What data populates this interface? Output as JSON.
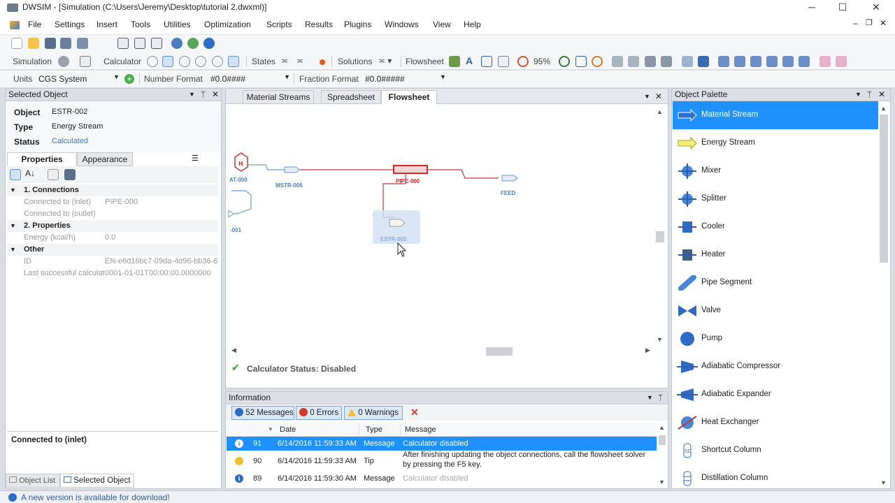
{
  "app": {
    "title": "DWSIM - [Simulation (C:\\Users\\Jeremy\\Desktop\\tutorial 2.dwxml)]"
  },
  "menu": [
    "File",
    "Settings",
    "Insert",
    "Tools",
    "Utilities",
    "Optimization",
    "Scripts",
    "Results",
    "Plugins",
    "Windows",
    "View",
    "Help"
  ],
  "toolbar": {
    "simulation": "Simulation",
    "calculator": "Calculator",
    "states": "States",
    "solutions": "Solutions",
    "flowsheet": "Flowsheet",
    "zoom": "95%"
  },
  "units": {
    "label": "Units",
    "value": "CGS System",
    "number_format_label": "Number Format",
    "number_format_value": "#0.0####",
    "fraction_format_label": "Fraction Format",
    "fraction_format_value": "#0.0#####"
  },
  "selected_object": {
    "header": "Selected Object",
    "object_label": "Object",
    "object_value": "ESTR-002",
    "type_label": "Type",
    "type_value": "Energy Stream",
    "status_label": "Status",
    "status_value": "Calculated",
    "tabs": [
      "Properties",
      "Appearance"
    ],
    "groups": {
      "connections": "1. Connections",
      "inlet_label": "Connected to (inlet)",
      "inlet_value": "PIPE-000",
      "outlet_label": "Connected to (outlet)",
      "properties": "2. Properties",
      "energy_label": "Energy (kcal/h)",
      "energy_value": "0.0",
      "other": "Other",
      "id_label": "ID",
      "id_value": "EN-e6d16bc7-09da-4d96-bb36-6",
      "last_label": "Last successful calculat",
      "last_value": "0001-01-01T00:00:00.0000000"
    },
    "description": "Connected to (inlet)",
    "bottom_tabs": [
      "Object List",
      "Selected Object"
    ]
  },
  "doc_tabs": [
    "Material Streams",
    "Spreadsheet",
    "Flowsheet"
  ],
  "flowsheet": {
    "labels": {
      "at000": "AT-000",
      "mstr006": "MSTR-006",
      "pipe000": "PIPE-000",
      "feed": "FEED",
      "estr002": "ESTR-002",
      "n001": "-001"
    },
    "calc_status": "Calculator Status: Disabled"
  },
  "information": {
    "header": "Information",
    "counts": {
      "messages": "52 Messages",
      "errors": "0 Errors",
      "warnings": "0 Warnings"
    },
    "columns": [
      "Date",
      "Type",
      "Message"
    ],
    "rows": [
      {
        "num": "91",
        "date": "6/14/2016 11:59:33 AM",
        "type": "Message",
        "msg": "Calculator disabled"
      },
      {
        "num": "90",
        "date": "6/14/2016 11:59:33 AM",
        "type": "Tip",
        "msg1": "After finishing updating the object connections, call the flowsheet solver",
        "msg2": "by pressing the F5 key."
      },
      {
        "num": "89",
        "date": "6/14/2016 11:59:30 AM",
        "type": "Message",
        "msg": "Calculator disabled"
      }
    ]
  },
  "palette": {
    "header": "Object Palette",
    "items": [
      "Material Stream",
      "Energy Stream",
      "Mixer",
      "Splitter",
      "Cooler",
      "Heater",
      "Pipe Segment",
      "Valve",
      "Pump",
      "Adiabatic Compressor",
      "Adiabatic Expander",
      "Heat Exchanger",
      "Shortcut Column",
      "Distillation Column"
    ]
  },
  "statusbar": {
    "text": "A new version is available for download!"
  },
  "colors": {
    "accent": "#3399ff",
    "selection": "#1e90ff",
    "panel": "#dcdfe5",
    "pipe": "#c0393b"
  }
}
